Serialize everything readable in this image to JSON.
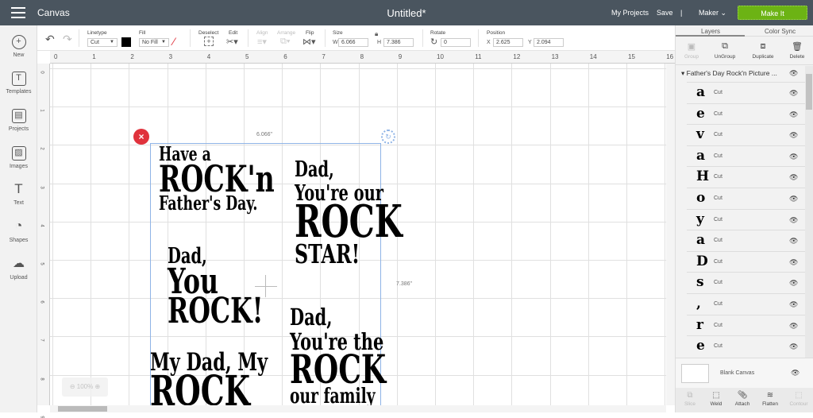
{
  "header": {
    "app": "Canvas",
    "title": "Untitled*",
    "my_projects": "My Projects",
    "save": "Save",
    "divider": "|",
    "machine": "Maker",
    "machine_chevron": "⌄",
    "make_it": "Make It"
  },
  "sidebar": [
    {
      "label": "New",
      "icon": "+"
    },
    {
      "label": "Templates",
      "icon": "T"
    },
    {
      "label": "Projects",
      "icon": "▤"
    },
    {
      "label": "Images",
      "icon": "▨"
    },
    {
      "label": "Text",
      "icon": "T"
    },
    {
      "label": "Shapes",
      "icon": "◔"
    },
    {
      "label": "Upload",
      "icon": "☁"
    }
  ],
  "toolbar": {
    "linetype_label": "Linetype",
    "linetype": "Cut",
    "fill_label": "Fill",
    "fill": "No Fill",
    "deselect": "Deselect",
    "edit": "Edit",
    "align": "Align",
    "arrange": "Arrange",
    "flip": "Flip",
    "size": "Size",
    "w_label": "W",
    "w": "6.066",
    "h_label": "H",
    "h": "7.386",
    "rotate": "Rotate",
    "rotate_value": "0",
    "position": "Position",
    "x_label": "X",
    "x": "2.625",
    "y_label": "Y",
    "y": "2.094"
  },
  "ruler_top": [
    "0",
    "1",
    "2",
    "3",
    "4",
    "5",
    "6",
    "7",
    "8",
    "9",
    "10",
    "11",
    "12",
    "13",
    "14",
    "15",
    "16"
  ],
  "ruler_left": [
    "0",
    "1",
    "2",
    "3",
    "4",
    "5",
    "6",
    "7",
    "8",
    "9"
  ],
  "canvas": {
    "width_dim": "6.066\"",
    "height_dim": "7.386\"",
    "zoom": "100%",
    "blocks": [
      {
        "lines": [
          "Have a",
          "ROCK'n",
          "Father's Day."
        ]
      },
      {
        "lines": [
          "Dad,",
          "You're our",
          "ROCK",
          "STAR!"
        ]
      },
      {
        "lines": [
          "Dad,",
          "You",
          "ROCK!"
        ]
      },
      {
        "lines": [
          "Dad,",
          "You're the",
          "ROCK",
          "our family"
        ]
      },
      {
        "lines": [
          "My Dad, My",
          "ROCK"
        ]
      }
    ]
  },
  "panel": {
    "tab_layers": "Layers",
    "tab_color_sync": "Color Sync",
    "actions": [
      "Group",
      "UnGroup",
      "Duplicate",
      "Delete"
    ],
    "group_name": "Father's Day Rock'n Picture ...",
    "layers": [
      {
        "glyph": "a",
        "type": "Cut"
      },
      {
        "glyph": "e",
        "type": "Cut"
      },
      {
        "glyph": "v",
        "type": "Cut"
      },
      {
        "glyph": "a",
        "type": "Cut"
      },
      {
        "glyph": "H",
        "type": "Cut"
      },
      {
        "glyph": "o",
        "type": "Cut"
      },
      {
        "glyph": "y",
        "type": "Cut"
      },
      {
        "glyph": "a",
        "type": "Cut"
      },
      {
        "glyph": "D",
        "type": "Cut"
      },
      {
        "glyph": "s",
        "type": "Cut"
      },
      {
        "glyph": ",",
        "type": "Cut"
      },
      {
        "glyph": "r",
        "type": "Cut"
      },
      {
        "glyph": "e",
        "type": "Cut"
      }
    ],
    "blank_canvas": "Blank Canvas",
    "bottom_actions": [
      "Slice",
      "Weld",
      "Attach",
      "Flatten",
      "Contour"
    ]
  }
}
